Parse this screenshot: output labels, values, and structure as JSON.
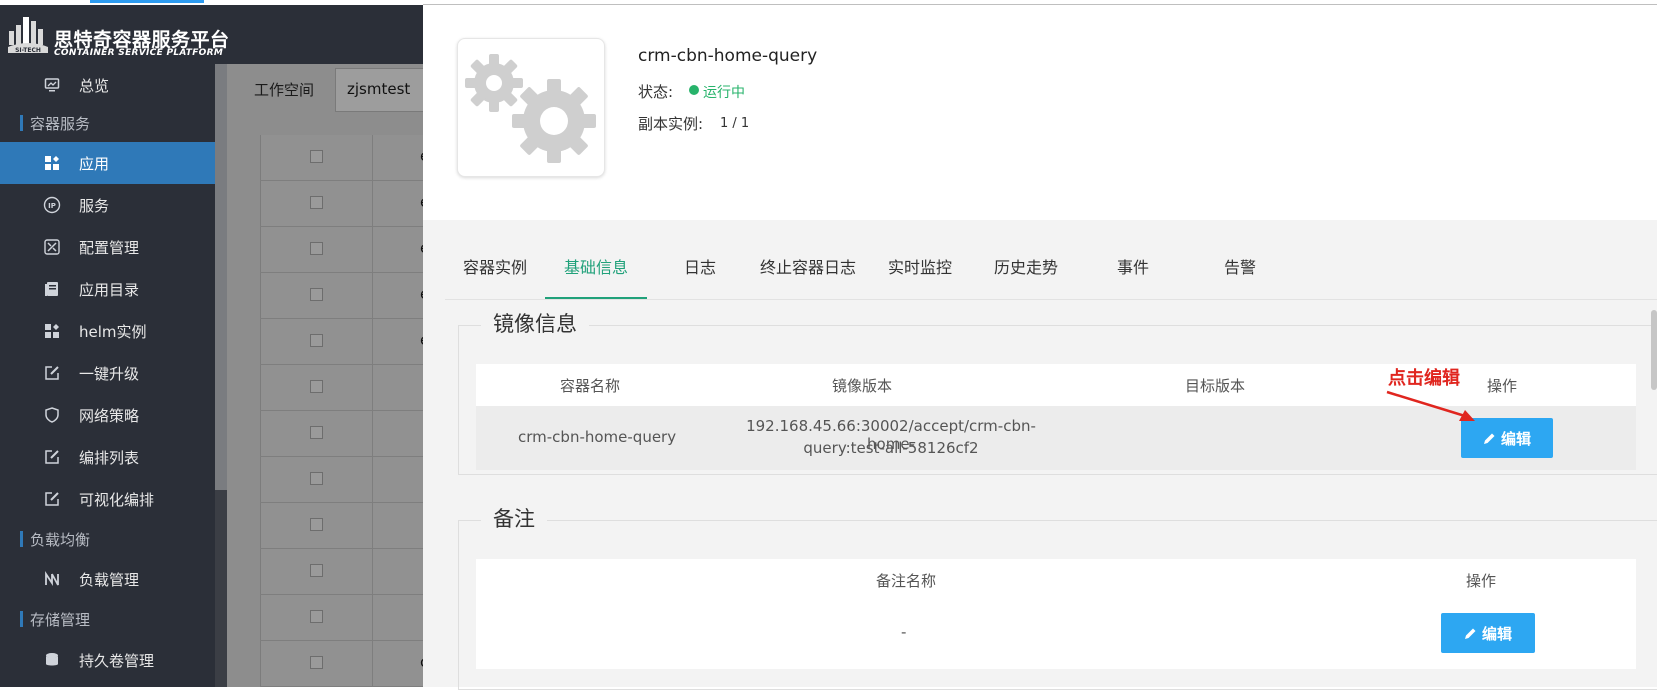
{
  "header": {
    "brand_cn": "思特奇容器服务平台",
    "brand_en": "CONTAINER SERVICE PLATFORM",
    "logo_text": "SI-TECH"
  },
  "sidebar": {
    "items": [
      {
        "type": "item",
        "label": "总览",
        "icon": "monitor-icon"
      },
      {
        "type": "group",
        "label": "容器服务"
      },
      {
        "type": "item",
        "label": "应用",
        "icon": "apps-grid-icon",
        "active": true
      },
      {
        "type": "item",
        "label": "服务",
        "icon": "ip-icon"
      },
      {
        "type": "item",
        "label": "配置管理",
        "icon": "tools-icon"
      },
      {
        "type": "item",
        "label": "应用目录",
        "icon": "catalog-icon"
      },
      {
        "type": "item",
        "label": "helm实例",
        "icon": "helm-grid-icon"
      },
      {
        "type": "item",
        "label": "一键升级",
        "icon": "edit-square-icon"
      },
      {
        "type": "item",
        "label": "网络策略",
        "icon": "shield-icon"
      },
      {
        "type": "item",
        "label": "编排列表",
        "icon": "edit-square-icon"
      },
      {
        "type": "item",
        "label": "可视化编排",
        "icon": "edit-square-icon"
      },
      {
        "type": "group",
        "label": "负载均衡"
      },
      {
        "type": "item",
        "label": "负载管理",
        "icon": "load-balance-icon"
      },
      {
        "type": "group",
        "label": "存储管理"
      },
      {
        "type": "item",
        "label": "持久卷管理",
        "icon": "database-icon"
      }
    ]
  },
  "background_page": {
    "workspace_label": "工作空间",
    "workspace_value": "zjsmtest",
    "rows": [
      "e",
      "e",
      "e",
      "e",
      "e",
      "",
      "",
      "",
      "",
      "",
      "",
      "cr"
    ]
  },
  "drawer": {
    "app_name": "crm-cbn-home-query",
    "status_label": "状态:",
    "status_value": "运行中",
    "status_color": "#27b36b",
    "replicas_label": "副本实例:",
    "replicas_value": "1 / 1",
    "tabs": [
      "容器实例",
      "基础信息",
      "日志",
      "终止容器日志",
      "实时监控",
      "历史走势",
      "事件",
      "告警"
    ],
    "active_tab": "基础信息",
    "image_section": {
      "title": "镜像信息",
      "columns": [
        "容器名称",
        "镜像版本",
        "目标版本",
        "操作"
      ],
      "rows": [
        {
          "container_name": "crm-cbn-home-query",
          "image_line1": "192.168.45.66:30002/accept/crm-cbn-home-",
          "image_line2": "query:test-all-58126cf2",
          "target_version": "",
          "action": "编辑"
        }
      ]
    },
    "note_section": {
      "title": "备注",
      "columns": [
        "备注名称",
        "操作"
      ],
      "rows": [
        {
          "name": "-",
          "action": "编辑"
        }
      ]
    }
  },
  "annotation": {
    "text": "点击编辑",
    "color": "#e0261f"
  },
  "colors": {
    "sidebar_bg": "#2b2f38",
    "sidebar_active": "#2f79b8",
    "accent_green": "#20a17a",
    "button_blue": "#2da7f2"
  }
}
